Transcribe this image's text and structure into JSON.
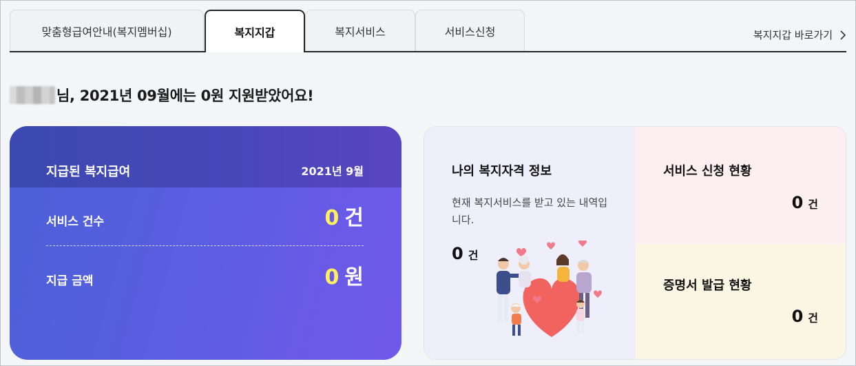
{
  "tabs": [
    {
      "label": "맞춤형급여안내(복지멤버십)",
      "active": false
    },
    {
      "label": "복지지갑",
      "active": true
    },
    {
      "label": "복지서비스",
      "active": false
    },
    {
      "label": "서비스신청",
      "active": false
    }
  ],
  "shortcut": {
    "label": "복지지갑 바로가기",
    "icon": "chevron-right-icon"
  },
  "greeting": {
    "text": "님, 2021년 09월에는 0원 지원받았어요!"
  },
  "payment_card": {
    "title": "지급된 복지급여",
    "date": "2021년  9월",
    "service_count_label": "서비스 건수",
    "service_count_value": "0",
    "service_count_unit": "건",
    "amount_label": "지급 금액",
    "amount_value": "0",
    "amount_unit": "원"
  },
  "qualification": {
    "title": "나의 복지자격 정보",
    "description": "현재 복지서비스를 받고 있는 내역입니다.",
    "count_value": "0",
    "count_unit": "건"
  },
  "service_status": {
    "title": "서비스 신청 현황",
    "count_value": "0",
    "count_unit": "건"
  },
  "certificate_status": {
    "title": "증명서 발급 현황",
    "count_value": "0",
    "count_unit": "건"
  },
  "colors": {
    "card_gradient_start": "#4a61d6",
    "card_gradient_end": "#7258ec",
    "highlight_number": "#fff25a",
    "qualification_bg": "#efeefb",
    "service_bg": "#fdeef2",
    "certificate_bg": "#fbf6e3"
  }
}
